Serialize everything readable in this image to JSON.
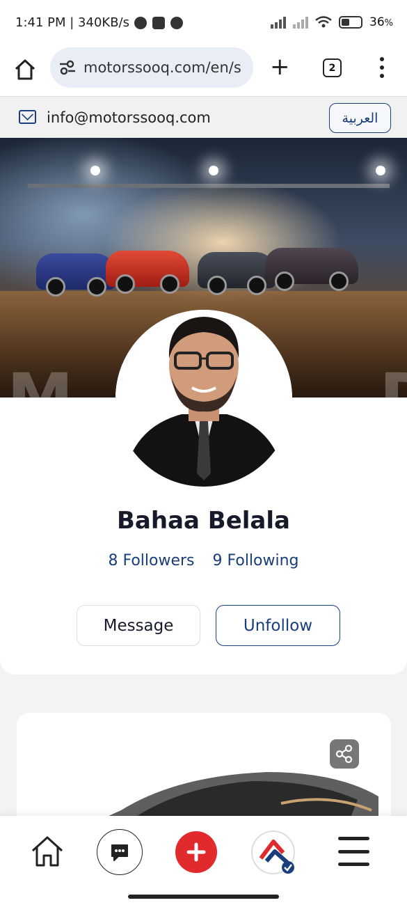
{
  "status_bar": {
    "time": "1:41 PM | 340KB/s",
    "battery": "36",
    "battery_unit": "%"
  },
  "browser": {
    "url": "motorssooq.com/en/s",
    "tab_count": "2"
  },
  "contact": {
    "email": "info@motorssooq.com",
    "language_button": "العربية"
  },
  "profile": {
    "name": "Bahaa Belala",
    "followers": "8 Followers",
    "following": "9 Following",
    "message_button": "Message",
    "unfollow_button": "Unfollow"
  },
  "bottom_nav": {
    "items": [
      "home-icon",
      "chat-icon",
      "add-icon",
      "profile-logo-icon",
      "menu-icon"
    ]
  },
  "colors": {
    "brand_blue": "#1a3d7c",
    "accent_red": "#e02a2e"
  }
}
